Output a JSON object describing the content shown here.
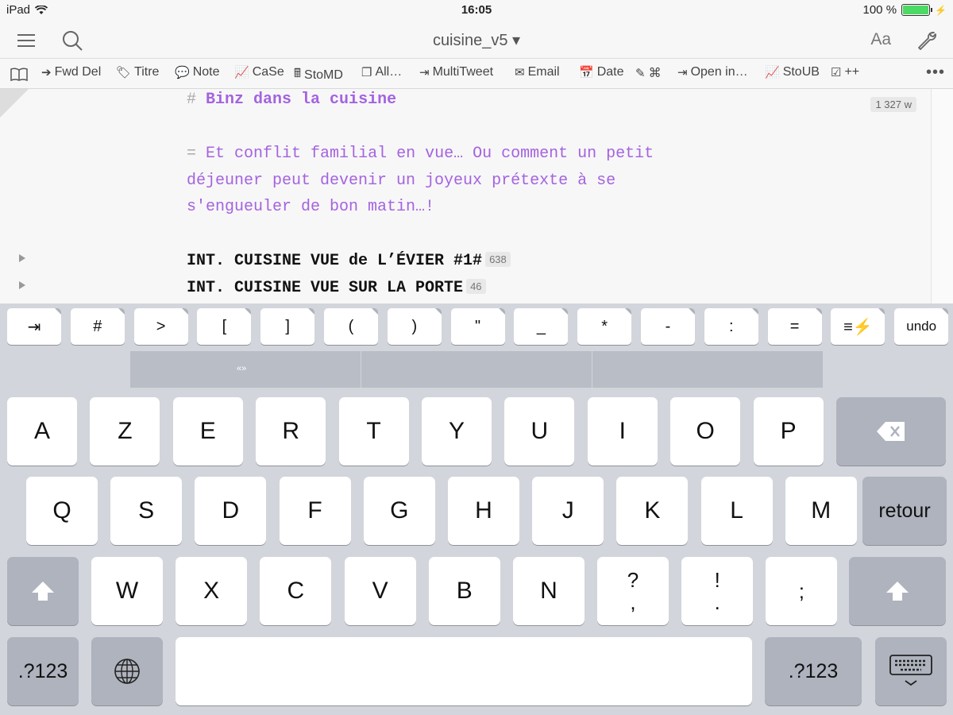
{
  "status": {
    "device": "iPad",
    "time": "16:05",
    "battery": "100 %",
    "battery_level": 1.0
  },
  "nav": {
    "title": "cuisine_v5 ▾",
    "font_label": "Aa"
  },
  "toolbar": {
    "items": [
      {
        "label": "Fwd Del",
        "icon": "forward-delete-icon"
      },
      {
        "label": "Titre",
        "icon": "tag-icon"
      },
      {
        "label": "Note",
        "icon": "speech-bubble-icon"
      },
      {
        "label": "CaSe",
        "icon": "chart-icon"
      },
      {
        "label": "StoMD",
        "icon": "cash-register-icon"
      },
      {
        "label": "All…",
        "icon": "copy-icon"
      },
      {
        "label": "MultiTweet",
        "icon": "share-out-icon"
      },
      {
        "label": "Email",
        "icon": "envelope-icon"
      },
      {
        "label": "Date",
        "icon": "calendar-icon"
      },
      {
        "label": "⌘",
        "icon": "edit-icon"
      },
      {
        "label": "Open in…",
        "icon": "share-out-icon"
      },
      {
        "label": "StoUB",
        "icon": "chart-icon"
      },
      {
        "label": "++",
        "icon": "checklist-icon"
      }
    ]
  },
  "editor": {
    "word_count": "1 327 w",
    "heading_marker": "#",
    "heading": "Binz dans la cuisine",
    "synopsis_marker": "=",
    "synopsis_1": "Et conflit familial en vue… Ou comment un petit",
    "synopsis_2": "déjeuner peut devenir un joyeux prétexte à se",
    "synopsis_3": "s'engueuler de bon matin…!",
    "scene_1": "INT. CUISINE VUE de L’ÉVIER #1#",
    "scene_1_count": "638",
    "scene_2": "INT. CUISINE VUE SUR LA PORTE",
    "scene_2_count": "46"
  },
  "extra_keys": [
    "⇥",
    "#",
    ">",
    "[",
    "]",
    "(",
    ")",
    "\"",
    "_",
    "*",
    "-",
    ":",
    "=",
    "≡⚡",
    "undo"
  ],
  "suggestions": {
    "left": "«»"
  },
  "keyboard": {
    "row1": [
      "A",
      "Z",
      "E",
      "R",
      "T",
      "Y",
      "U",
      "I",
      "O",
      "P"
    ],
    "row2": [
      "Q",
      "S",
      "D",
      "F",
      "G",
      "H",
      "J",
      "K",
      "L",
      "M"
    ],
    "return_label": "retour",
    "row3": [
      "W",
      "X",
      "C",
      "V",
      "B",
      "N"
    ],
    "punct": [
      [
        "?",
        ","
      ],
      [
        "!",
        "."
      ],
      [
        "",
        ";"
      ]
    ],
    "numbers_label": ".?123"
  }
}
